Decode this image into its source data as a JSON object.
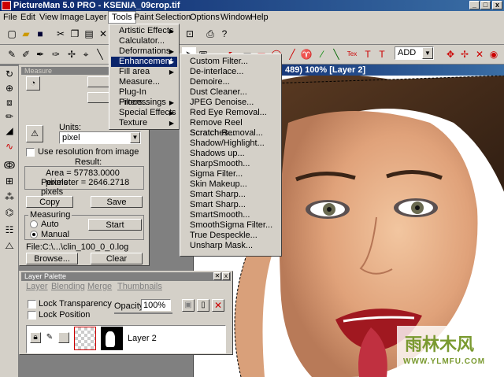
{
  "app_title": "PictureMan 5.0 PRO - KSENIA_09crop.tif",
  "window_controls": {
    "minimize": "_",
    "maximize": "□",
    "close": "x"
  },
  "menubar": [
    "File",
    "Edit",
    "View",
    "Image",
    "Layer",
    "Tools",
    "Paint",
    "Selection",
    "Options",
    "Window",
    "Help"
  ],
  "toolbar": {
    "mode_select": "ADD"
  },
  "tools_menu": [
    {
      "label": "Artistic Effects",
      "sub": true
    },
    {
      "label": "Calculator...",
      "sub": false
    },
    {
      "label": "Deformations",
      "sub": true
    },
    {
      "label": "Enhancement",
      "sub": true
    },
    {
      "label": "Fill area",
      "sub": true
    },
    {
      "label": "Measure...",
      "sub": false
    },
    {
      "label": "Plug-In Filters...",
      "sub": false
    },
    {
      "label": "Processings",
      "sub": true
    },
    {
      "label": "Special Effects",
      "sub": true
    },
    {
      "label": "Texture",
      "sub": true
    }
  ],
  "enhancement_menu": [
    "Custom Filter...",
    "De-interlace...",
    "Demoire...",
    "Dust Cleaner...",
    "JPEG Denoise...",
    "Red Eye Removal...",
    "Remove Reel Scratches...",
    "Scratch Removal...",
    "Shadow/Highlight...",
    "Shadows up...",
    "SharpSmooth...",
    "Sigma Filter...",
    "Skin Makeup...",
    "Smart Sharp...",
    "Smart Sharp...",
    "SmartSmooth...",
    "SmoothSigma Filter...",
    "True Despeckle...",
    "Unsharp Mask..."
  ],
  "image_window": {
    "title": "489) 100% [Layer 2]"
  },
  "measure": {
    "title": "Measure",
    "units_label": "Units:",
    "units_value": "pixel",
    "use_resolution": "Use resolution from image",
    "result_label": "Result:",
    "area": "Area = 57783.0000 pixels",
    "perimeter": "Perimeter = 2646.2718 pixels",
    "copy": "Copy",
    "save": "Save",
    "measuring_label": "Measuring",
    "auto": "Auto",
    "manual": "Manual",
    "start": "Start",
    "file": "File:C:\\...\\clin_100_0_0.log",
    "browse": "Browse...",
    "clear": "Clear"
  },
  "layer_palette": {
    "title": "Layer Palette",
    "menu": [
      "Layer",
      "Blending",
      "Merge",
      "Thumbnails"
    ],
    "lock_transparency": "Lock Transparency",
    "lock_position": "Lock Position",
    "opacity_label": "Opacity:",
    "opacity_value": "100%",
    "layer_name": "Layer 2"
  },
  "watermark": {
    "brand": "雨林木风",
    "url": "WWW.YLMFU.COM"
  },
  "colors": {
    "title_start": "#0a246a",
    "title_end": "#3a6ea5",
    "face": "#d4d0c8",
    "highlight": "#0a246a"
  }
}
